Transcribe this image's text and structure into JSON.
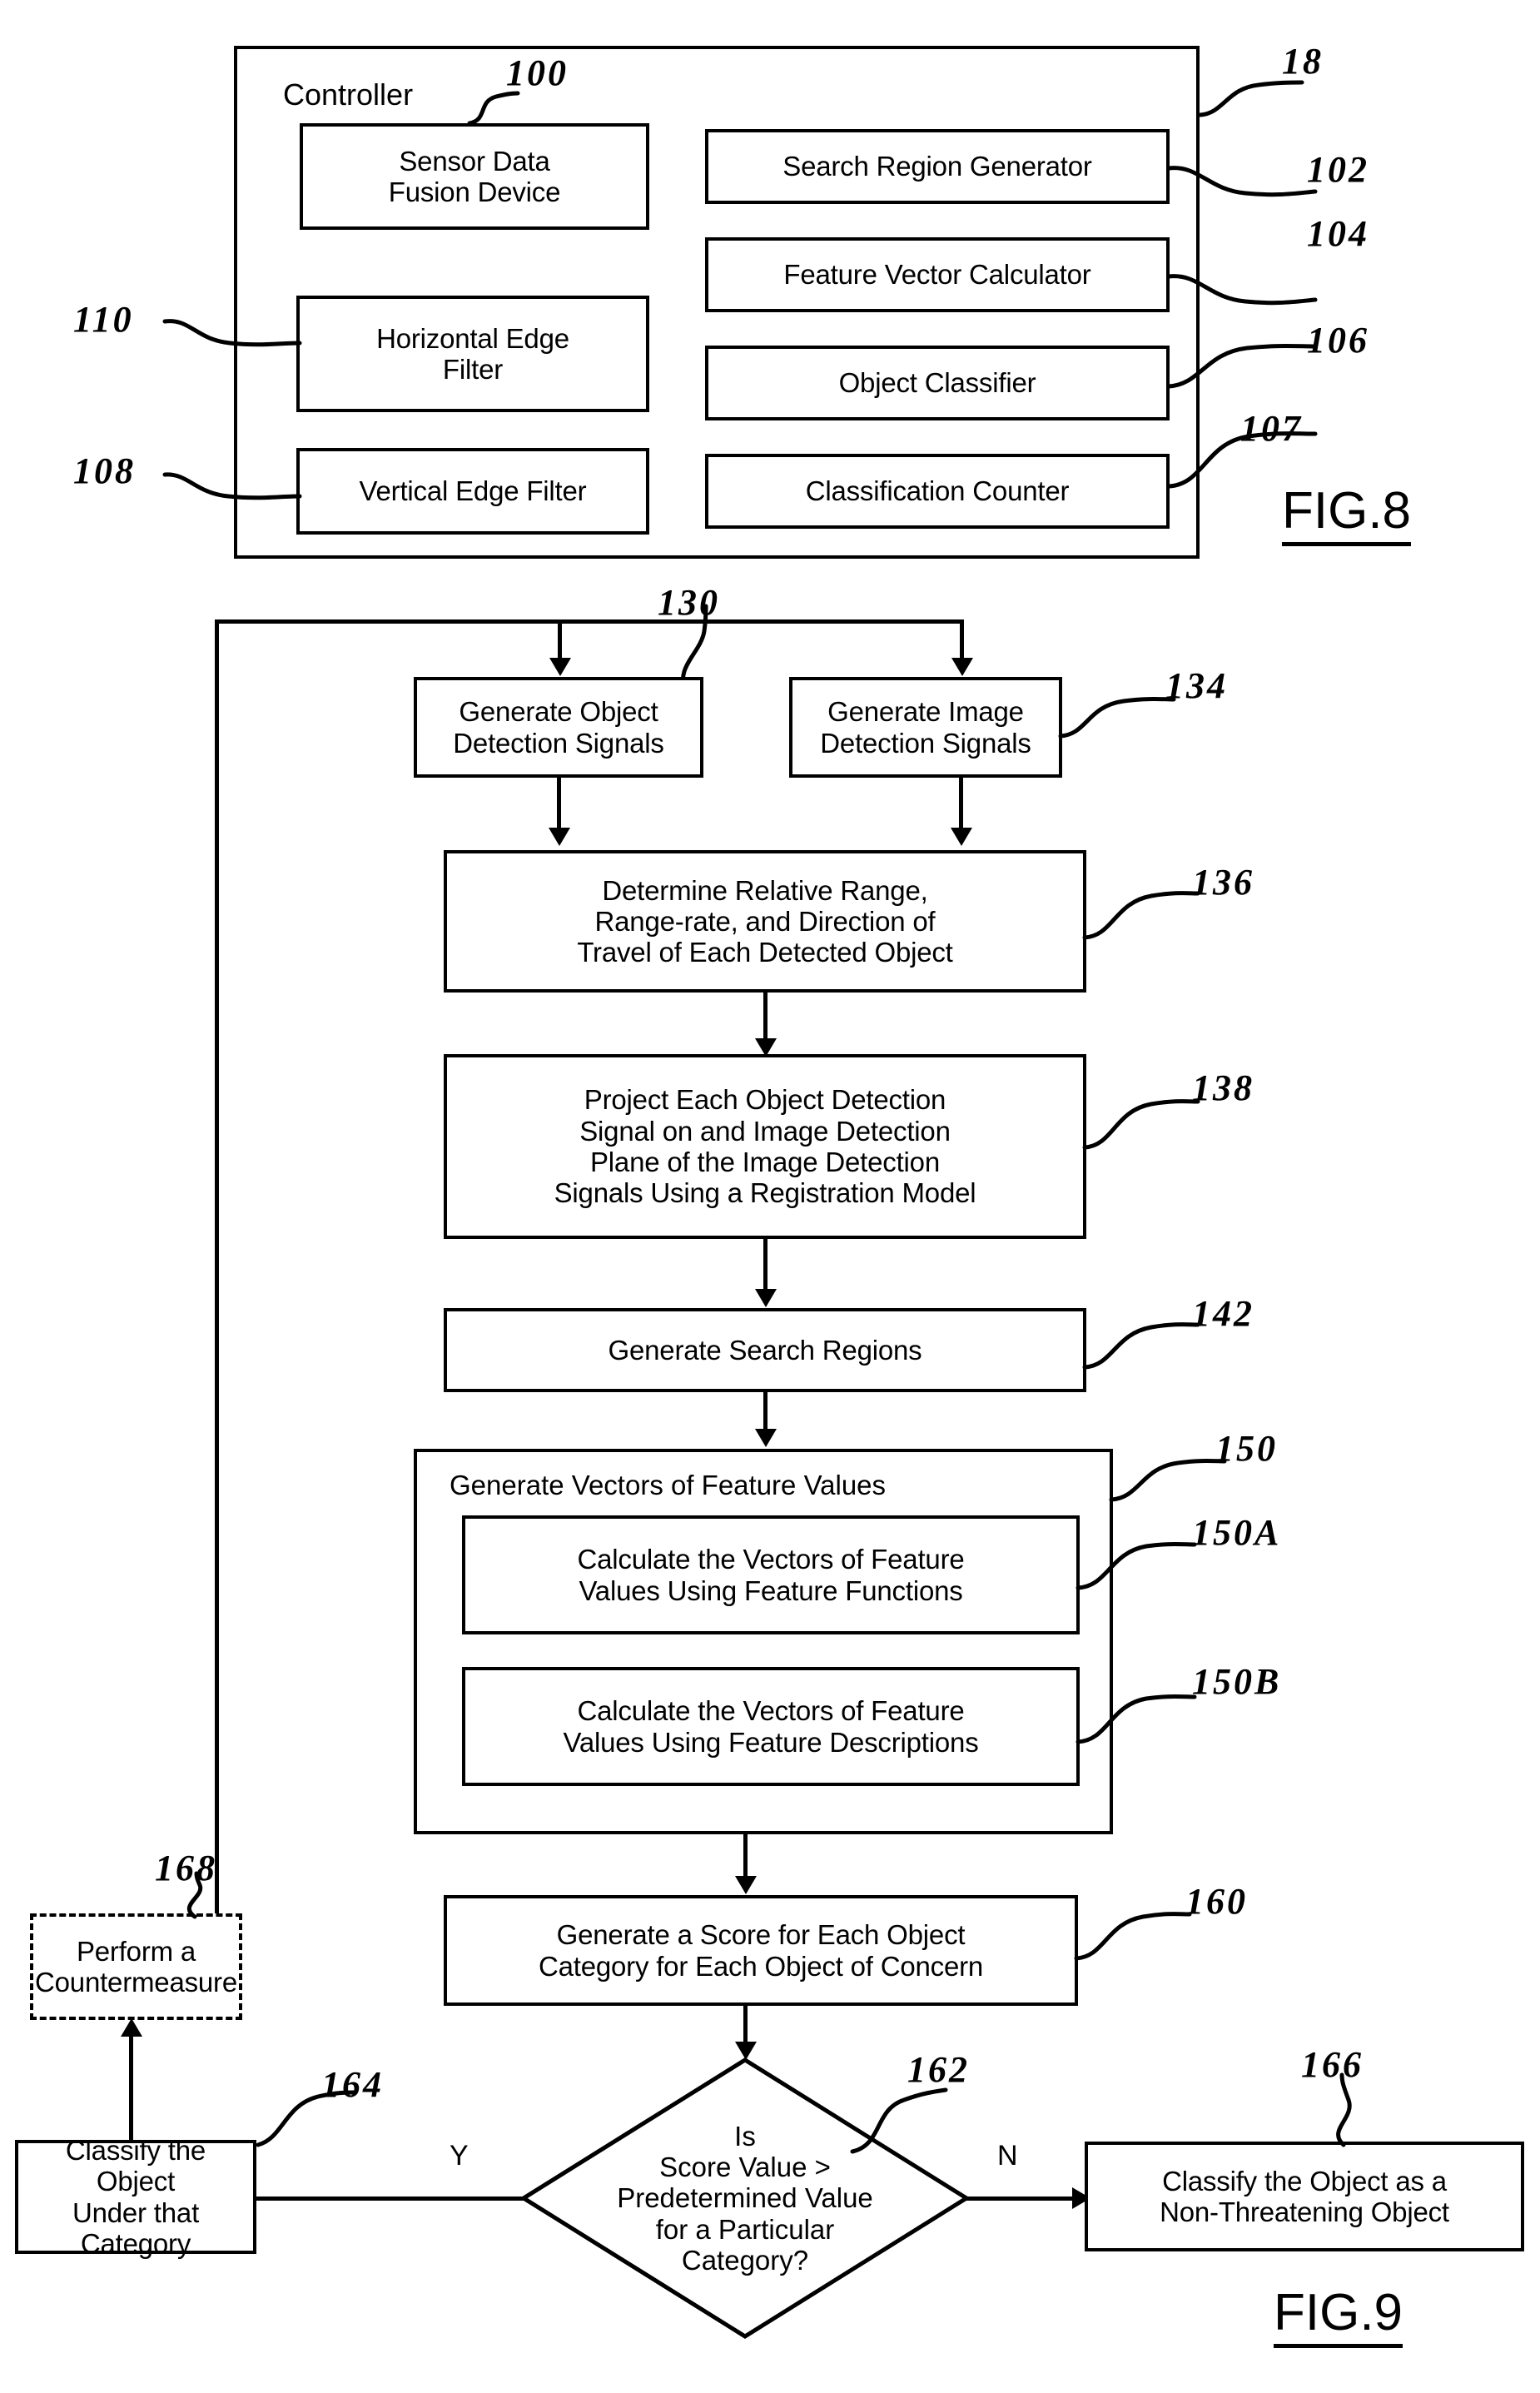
{
  "figures": [
    {
      "caption": "FIG.8",
      "title": "Controller",
      "outer_ref": "18",
      "blocks": [
        {
          "label": "Sensor Data\nFusion Device",
          "ref": "100"
        },
        {
          "label": "Horizontal Edge\nFilter",
          "ref": "110"
        },
        {
          "label": "Vertical Edge Filter",
          "ref": "108"
        },
        {
          "label": "Search Region Generator",
          "ref": "102"
        },
        {
          "label": "Feature Vector Calculator",
          "ref": "104"
        },
        {
          "label": "Object Classifier",
          "ref": "106"
        },
        {
          "label": "Classification Counter",
          "ref": "107"
        }
      ]
    },
    {
      "caption": "FIG.9",
      "flow_ref": "130",
      "steps": [
        {
          "label": "Generate Object\nDetection Signals",
          "ref": "130"
        },
        {
          "label": "Generate Image\nDetection Signals",
          "ref": "134"
        },
        {
          "label": "Determine Relative Range,\nRange-rate, and Direction of\nTravel of Each Detected Object",
          "ref": "136"
        },
        {
          "label": "Project Each Object Detection\nSignal on and Image Detection\nPlane of the Image Detection\nSignals Using a Registration Model",
          "ref": "138"
        },
        {
          "label": "Generate Search Regions",
          "ref": "142"
        },
        {
          "label": "Generate Vectors of Feature Values",
          "ref": "150"
        },
        {
          "label": "Calculate the Vectors of Feature\nValues Using Feature Functions",
          "ref": "150A"
        },
        {
          "label": "Calculate the Vectors of Feature\nValues Using Feature Descriptions",
          "ref": "150B"
        },
        {
          "label": "Generate a Score for Each Object\nCategory for Each Object of Concern",
          "ref": "160"
        },
        {
          "label": "Is\nScore Value >\nPredetermined Value\nfor a Particular\nCategory?",
          "ref": "162",
          "shape": "decision"
        },
        {
          "label": "Classify the Object\nUnder that Category",
          "ref": "164"
        },
        {
          "label": "Classify the Object as a\nNon-Threatening Object",
          "ref": "166"
        },
        {
          "label": "Perform a\nCountermeasure",
          "ref": "168",
          "style": "dashed"
        }
      ],
      "branch_labels": {
        "yes": "Y",
        "no": "N"
      }
    }
  ],
  "fig8": {
    "caption": "FIG.8",
    "title": "Controller",
    "outer_ref": "18",
    "left": [
      {
        "label": "Sensor Data\nFusion Device",
        "ref": "100"
      },
      {
        "label": "Horizontal Edge\nFilter",
        "ref": "110"
      },
      {
        "label": "Vertical Edge Filter",
        "ref": "108"
      }
    ],
    "right": [
      {
        "label": "Search Region Generator",
        "ref": "102"
      },
      {
        "label": "Feature Vector Calculator",
        "ref": "104"
      },
      {
        "label": "Object Classifier",
        "ref": "106"
      },
      {
        "label": "Classification Counter",
        "ref": "107"
      }
    ]
  },
  "fig9": {
    "caption": "FIG.9",
    "ref_130": "130",
    "ref_134": "134",
    "ref_136": "136",
    "ref_138": "138",
    "ref_142": "142",
    "ref_150": "150",
    "ref_150a": "150A",
    "ref_150b": "150B",
    "ref_160": "160",
    "ref_162": "162",
    "ref_164": "164",
    "ref_166": "166",
    "ref_168": "168",
    "step_130": "Generate Object\nDetection Signals",
    "step_134": "Generate Image\nDetection Signals",
    "step_136": "Determine Relative Range,\nRange-rate, and Direction of\nTravel of Each Detected Object",
    "step_138": "Project Each Object Detection\nSignal on and Image Detection\nPlane of the Image Detection\nSignals Using a Registration Model",
    "step_142": "Generate Search Regions",
    "step_150": "Generate Vectors of Feature Values",
    "step_150a": "Calculate the Vectors of Feature\nValues Using Feature Functions",
    "step_150b": "Calculate the Vectors of Feature\nValues Using Feature Descriptions",
    "step_160": "Generate a Score for Each Object\nCategory for Each Object of Concern",
    "step_162": "Is\nScore Value >\nPredetermined Value\nfor a Particular\nCategory?",
    "step_164": "Classify the Object\nUnder that Category",
    "step_166": "Classify the Object as a\nNon-Threatening Object",
    "step_168": "Perform a\nCountermeasure",
    "label_yes": "Y",
    "label_no": "N"
  }
}
